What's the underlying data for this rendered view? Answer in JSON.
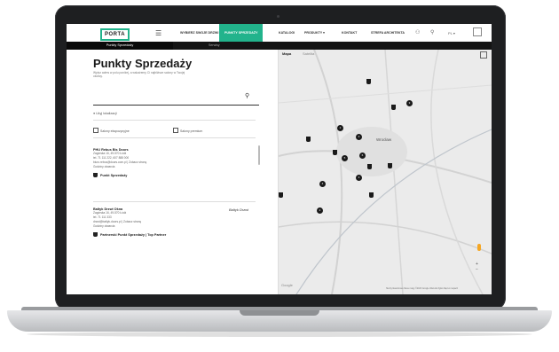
{
  "nav": {
    "logo": "PORTA",
    "items": [
      {
        "label": "WYBIERZ SWOJE DRZWI",
        "active": false
      },
      {
        "label": "PUNKTY SPRZEDAŻY",
        "active": true
      },
      {
        "label": "KATALOGI",
        "active": false
      },
      {
        "label": "PRODUKTY ▾",
        "active": false
      },
      {
        "label": "KONTAKT",
        "active": false
      },
      {
        "label": "STREFA ARCHITEKTA",
        "active": false
      }
    ],
    "language": "PL ▾"
  },
  "subheader": {
    "left": "Punkty Sprzedaży",
    "middle": "Serwisy"
  },
  "panel": {
    "title": "Punkty Sprzedaży",
    "description": "Wpisz adres w polu poniżej, a wskażemy Ci najbliższe salony w Twojej okolicy.",
    "search_placeholder": "",
    "use_location": "Użyj lokalizacji",
    "filters": [
      "Salony ekspozycyjne",
      "Salony premium"
    ],
    "cards": [
      {
        "name": "PHU Rebus Bis Doors",
        "address": "Zagórska 16, 49-570 Łódź",
        "phone": "tel. 71 111 222, 607 888 000",
        "email": "biuro.rebus@doors.com.pl | Zobacz stronę",
        "hours": "Godziny otwarcia",
        "tag": "Punkt Sprzedaży"
      },
      {
        "name": "Baltyk Drzwi Okna",
        "address": "Zagórska 16, 49-570 Łódź",
        "phone": "tel. 71 111 333",
        "email": "drzwi@baltyk-doors.pl | Zobacz stronę",
        "hours": "Godziny otwarcia",
        "tag": "Partnerski Punkt Sprzedaży | Top Partner"
      }
    ],
    "brand_logo": "Baltyk Drzwi"
  },
  "map": {
    "tabs": [
      "Mapa",
      "Satelita"
    ],
    "city_label": "Wrocław",
    "clusters": [
      "3",
      "2",
      "3",
      "5",
      "6",
      "4",
      "2",
      "3"
    ],
    "google": "Google",
    "attribution": "Skróty klawiszowe  Dane mapy ©2023 Google  Warunki  Zgłoś błąd w mapach"
  }
}
